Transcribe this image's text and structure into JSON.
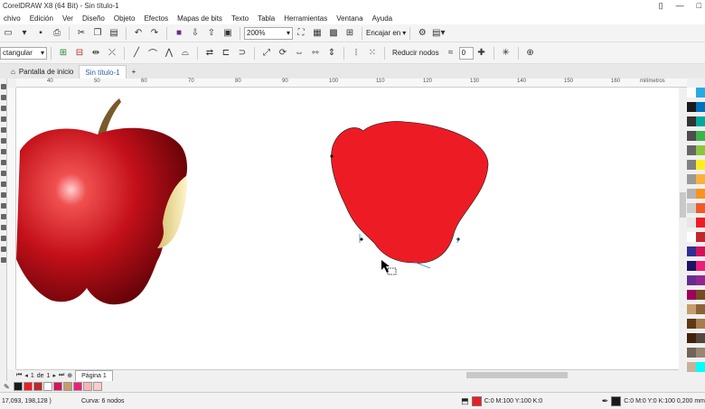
{
  "app": {
    "title": "CorelDRAW X8 (64 Bit) - Sin título-1",
    "win_controls": [
      "▯",
      "—",
      "□"
    ]
  },
  "menu": [
    "chivo",
    "Edición",
    "Ver",
    "Diseño",
    "Objeto",
    "Efectos",
    "Mapas de bits",
    "Texto",
    "Tabla",
    "Herramientas",
    "Ventana",
    "Ayuda"
  ],
  "toolbar1": {
    "zoom_value": "200%",
    "snap_label": "Encajar en"
  },
  "toolbar2": {
    "shape_label": "ctangular",
    "reduce_nodes_label": "Reducir nodos",
    "node_count_value": "0"
  },
  "tabs": {
    "home_label": "Pantalla de inicio",
    "doc_label": "Sin título-1",
    "add_label": "+"
  },
  "ruler": {
    "ticks": [
      "40",
      "50",
      "60",
      "70",
      "80",
      "90",
      "100",
      "110",
      "120",
      "130",
      "140",
      "150",
      "160",
      "milímetros"
    ]
  },
  "pages": {
    "current": "1",
    "of_label": "de",
    "total": "1",
    "page_tab": "Página 1"
  },
  "status": {
    "cursor_position": "17,093, 198,128 )",
    "object_info": "Curva: 6 nodos",
    "fill_info": "C:0 M:100 Y:100 K:0",
    "outline_info": "C:0 M:0 Y:0 K:100  0,200 mm"
  },
  "colors": {
    "apple_red": "#ed1c24",
    "fill_swatch": "#ed1c24",
    "outline_swatch": "#1a1a1a"
  },
  "palette_colors": [
    "#ffffff",
    "#29abe2",
    "#1a1a1a",
    "#0071bc",
    "#333333",
    "#00a99d",
    "#4d4d4d",
    "#39b54a",
    "#666666",
    "#8cc63f",
    "#808080",
    "#fcee21",
    "#999999",
    "#fbb03b",
    "#b3b3b3",
    "#f7931e",
    "#cccccc",
    "#f15a24",
    "#e6e6e6",
    "#ed1c24",
    "#ffffff",
    "#c1272d",
    "#2e3192",
    "#d4145a",
    "#1b1464",
    "#ed1e79",
    "#662d91",
    "#93278f",
    "#9e005d",
    "#754c24",
    "#c69c6d",
    "#8c6239",
    "#603813",
    "#a67c52",
    "#42210b",
    "#534741",
    "#736357",
    "#998675",
    "#c7b299",
    "#00ffff"
  ],
  "doc_palette": [
    "#1a1a1a",
    "#ed1c24",
    "#c1272d",
    "#ffffff",
    "#d4145a",
    "#c69c6d",
    "#ed1e79",
    "#f5b7b1",
    "#ffcccc"
  ]
}
